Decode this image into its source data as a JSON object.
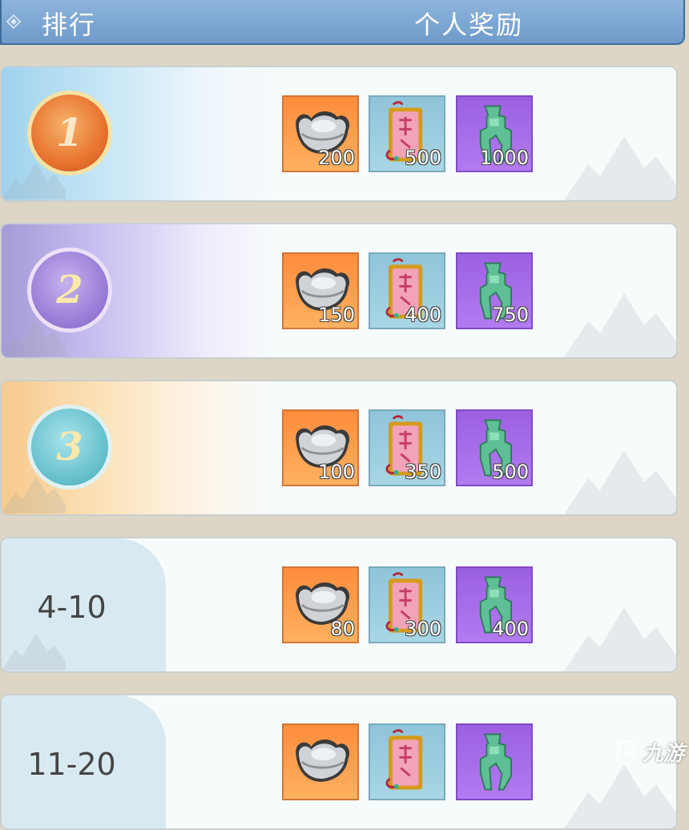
{
  "header": {
    "rank_label": "排行",
    "reward_label": "个人奖励"
  },
  "rows": [
    {
      "rank": "1",
      "rewards": [
        "200",
        "500",
        "1000"
      ]
    },
    {
      "rank": "2",
      "rewards": [
        "150",
        "400",
        "750"
      ]
    },
    {
      "rank": "3",
      "rewards": [
        "100",
        "350",
        "500"
      ]
    },
    {
      "rank": "4-10",
      "rewards": [
        "80",
        "300",
        "400"
      ]
    },
    {
      "rank": "11-20",
      "rewards": [
        "",
        "",
        ""
      ]
    }
  ],
  "icons": [
    "silver-ingot-icon",
    "red-token-icon",
    "jade-coin-icon"
  ],
  "watermark": "九游"
}
